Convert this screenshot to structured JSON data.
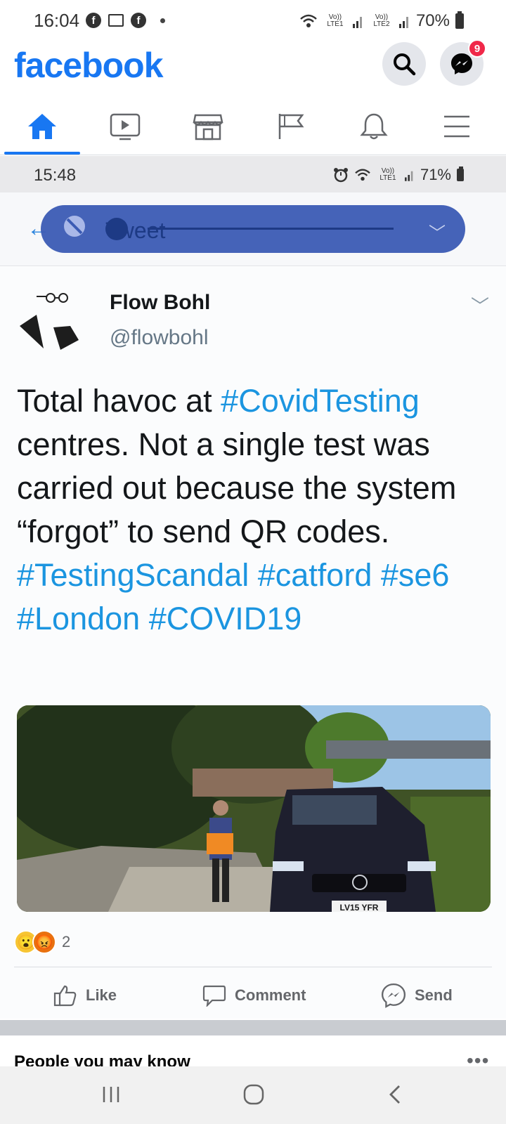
{
  "status_bar": {
    "time": "16:04",
    "network_1": "Vo)) LTE1",
    "network_2": "Vo)) LTE2",
    "battery": "70%"
  },
  "header": {
    "logo": "facebook",
    "messenger_badge": "9"
  },
  "nav": {
    "tabs": [
      "home",
      "watch",
      "marketplace",
      "pages",
      "notifications",
      "menu"
    ],
    "active": "home"
  },
  "embedded_screenshot": {
    "status_time": "15:48",
    "status_network": "Vo)) LTE1",
    "status_battery": "71%",
    "title": "Tweet"
  },
  "tweet": {
    "name": "Flow Bohl",
    "handle": "@flowbohl",
    "text_segments": [
      {
        "text": "Total havoc at ",
        "hashtag": false
      },
      {
        "text": "#CovidTesting",
        "hashtag": true
      },
      {
        "text": " centres. Not a single test was carried out because the system “forgot” to send QR codes. ",
        "hashtag": false
      },
      {
        "text": "#TestingScandal",
        "hashtag": true
      },
      {
        "text": " ",
        "hashtag": false
      },
      {
        "text": "#catford",
        "hashtag": true
      },
      {
        "text": " ",
        "hashtag": false
      },
      {
        "text": "#se6",
        "hashtag": true
      },
      {
        "text": " ",
        "hashtag": false
      },
      {
        "text": "#London",
        "hashtag": true
      },
      {
        "text": " ",
        "hashtag": false
      },
      {
        "text": "#COVID19",
        "hashtag": true
      }
    ],
    "plate": "LV15 YFR"
  },
  "post": {
    "reaction_count": "2",
    "like_label": "Like",
    "comment_label": "Comment",
    "send_label": "Send"
  },
  "people_you_may_know": {
    "title": "People you may know",
    "more": "•••"
  },
  "colors": {
    "brand": "#1877f2",
    "hashtag": "#1b95e0",
    "badge": "#f02849"
  }
}
